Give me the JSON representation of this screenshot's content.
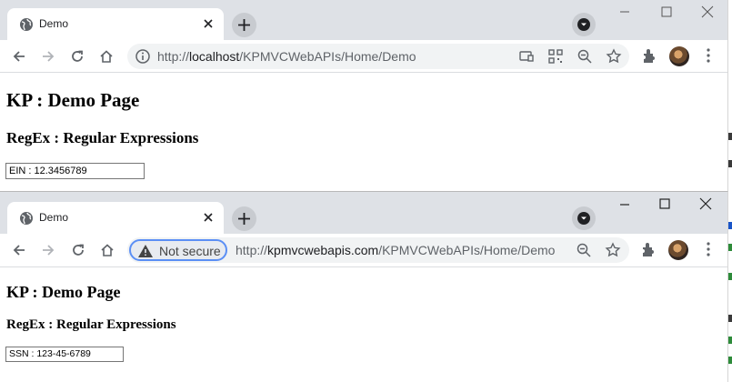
{
  "windows": [
    {
      "tab": {
        "title": "Demo",
        "close_icon": "close-icon"
      },
      "omnibox": {
        "security": "info",
        "url_prefix": "http://",
        "url_host": "localhost",
        "url_path": "/KPMVCWebAPIs/Home/Demo"
      },
      "page": {
        "heading": "KP : Demo Page",
        "subheading": "RegEx : Regular Expressions",
        "input_value": "EIN : 12.3456789"
      }
    },
    {
      "tab": {
        "title": "Demo",
        "close_icon": "close-icon"
      },
      "omnibox": {
        "security": "not-secure",
        "security_label": "Not secure",
        "url_prefix": "http://",
        "url_host": "kpmvcwebapis.com",
        "url_path": "/KPMVCWebAPIs/Home/Demo"
      },
      "page": {
        "heading": "KP : Demo Page",
        "subheading": "RegEx : Regular Expressions",
        "input_value": "SSN : 123-45-6789"
      }
    }
  ],
  "colors": {
    "tabstrip_bg": "#dee1e6",
    "omnibox_bg": "#f1f3f4",
    "focus_ring": "#5b8ff5",
    "text": "#202124"
  }
}
